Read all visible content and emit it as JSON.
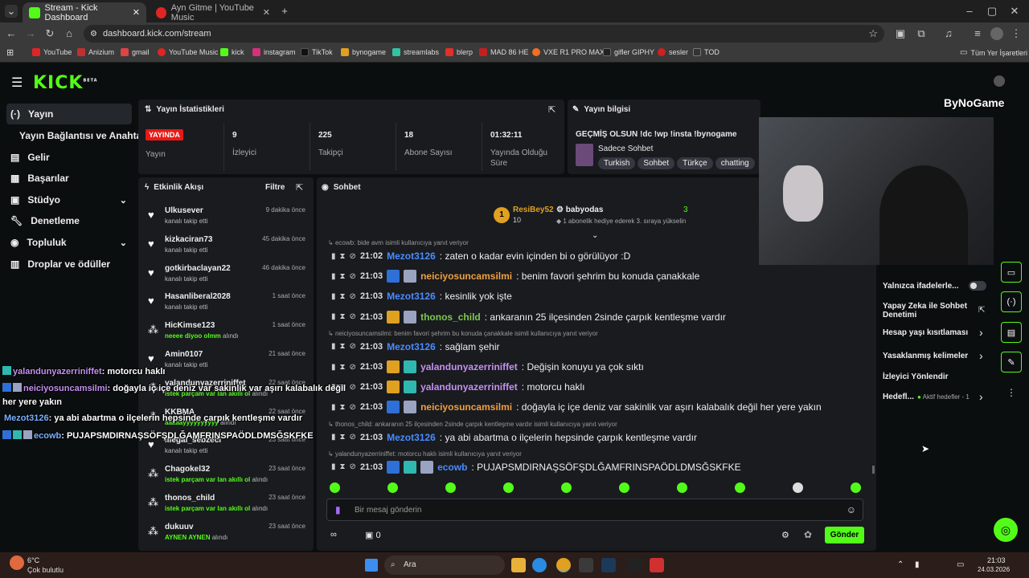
{
  "browser": {
    "tabs": [
      {
        "title": "Stream - Kick Dashboard"
      },
      {
        "title": "Ayn Gitme | YouTube Music"
      }
    ],
    "url": "dashboard.kick.com/stream",
    "bookmarks": [
      "YouTube",
      "Anizium",
      "gmail",
      "YouTube Music",
      "kick",
      "instagram",
      "TikTok",
      "bynogame",
      "streamlabs",
      "blerp",
      "MAD 86 HE",
      "VXE R1 PRO MAX",
      "gifler GIPHY",
      "sesler",
      "TOD"
    ],
    "all_bookmarks": "Tüm Yer İşaretleri"
  },
  "kick": {
    "logo": "KICK",
    "logo_sup": "BETA"
  },
  "sidebar": {
    "items": [
      {
        "label": "Yayın",
        "icon": "broadcast-icon"
      },
      {
        "label": "Yayın Bağlantısı ve Anahtarı"
      },
      {
        "label": "Gelir",
        "icon": "money-icon"
      },
      {
        "label": "Başarılar",
        "icon": "trophy-icon"
      },
      {
        "label": "Stüdyo",
        "icon": "studio-icon"
      },
      {
        "label": "Denetleme",
        "icon": "wrench-icon"
      },
      {
        "label": "Topluluk",
        "icon": "community-icon"
      },
      {
        "label": "Droplar ve ödüller",
        "icon": "gift-icon"
      }
    ]
  },
  "stats": {
    "title": "Yayın İstatistikleri",
    "live_badge": "YAYINDA",
    "live_label": "Yayın",
    "cells": [
      {
        "value": "9",
        "label": "İzleyici"
      },
      {
        "value": "225",
        "label": "Takipçi"
      },
      {
        "value": "18",
        "label": "Abone Sayısı"
      },
      {
        "value": "01:32:11",
        "label": "Yayında Olduğu Süre"
      }
    ]
  },
  "stream_info": {
    "title": "Yayın bilgisi",
    "stream_title": "GEÇMİŞ OLSUN !dc !wp !insta !bynogame",
    "category": "Sadece Sohbet",
    "tags": [
      "Turkish",
      "Sohbet",
      "Türkçe",
      "chatting"
    ]
  },
  "activity": {
    "title": "Etkinlik Akışı",
    "filter": "Filtre",
    "items": [
      {
        "name": "Ulkusever",
        "time": "9 dakika önce",
        "sub": "kanalı takip etti",
        "icon": "heart"
      },
      {
        "name": "kizkaciran73",
        "time": "45 dakika önce",
        "sub": "kanalı takip etti",
        "icon": "heart"
      },
      {
        "name": "gotkirbaclayan22",
        "time": "46 dakika önce",
        "sub": "kanalı takip etti",
        "icon": "heart"
      },
      {
        "name": "Hasanliberal2028",
        "time": "1 saat önce",
        "sub": "kanalı takip etti",
        "icon": "heart"
      },
      {
        "name": "HicKimse123",
        "time": "1 saat önce",
        "hl": "neeee diyoo olmm",
        "sub": "alındı",
        "icon": "reward"
      },
      {
        "name": "Amin0107",
        "time": "21 saat önce",
        "sub": "kanalı takip etti",
        "icon": "heart"
      },
      {
        "name": "yalandunyazerriniffet",
        "time": "22 saat önce",
        "hl": "istek parçam var lan akıllı ol",
        "sub": "alındı",
        "icon": "reward"
      },
      {
        "name": "KKBMA",
        "time": "22 saat önce",
        "hl": "aaaaayyyyyyyyyy",
        "sub": "alındı",
        "icon": "reward"
      },
      {
        "name": "illegal_sebzeci",
        "time": "23 saat önce",
        "sub": "kanalı takip etti",
        "icon": "heart"
      },
      {
        "name": "Chagokel32",
        "time": "23 saat önce",
        "hl": "istek parçam var lan akıllı ol",
        "sub": "alındı",
        "icon": "reward"
      },
      {
        "name": "thonos_child",
        "time": "23 saat önce",
        "hl": "istek parçam var lan akıllı ol",
        "sub": "alındı",
        "icon": "reward"
      },
      {
        "name": "dukuuv",
        "time": "23 saat önce",
        "hl": "AYNEN AYNEN",
        "sub": "alındı",
        "icon": "reward"
      }
    ]
  },
  "chat": {
    "title": "Sohbet",
    "pinned_user": "ResiBey52",
    "pinned_count": "10",
    "gift_user": "babyodas",
    "gift_count": "3",
    "gift_text": "1 abonelik hediye ederek 3. sıraya yükselin",
    "messages": [
      {
        "reply": "ecowb: bide avm isimli kullanıcıya yanıt veriyor",
        "time": "21:02",
        "user": "Mezot3126",
        "color": "#4a8cff",
        "text": ": zaten o kadar evin içinden bi o görülüyor :D",
        "badges": []
      },
      {
        "time": "21:03",
        "user": "neiciyosuncamsilmi",
        "color": "#f0a040",
        "text": ": benim favori şehrim bu konuda çanakkale",
        "badges": [
          "#2f6fd8",
          "#9aa3c0"
        ]
      },
      {
        "time": "21:03",
        "user": "Mezot3126",
        "color": "#4a8cff",
        "text": ": kesinlik yok işte",
        "badges": []
      },
      {
        "time": "21:03",
        "user": "thonos_child",
        "color": "#7ec850",
        "text": ": ankaranın 25 ilçesinden 2sinde çarpık kentleşme vardır",
        "badges": [
          "#e0a020",
          "#9aa3c0"
        ]
      },
      {
        "reply": "neiciyosuncamsilmi: benim favori şehrim bu konuda çanakkale isimli kullanıcıya yanıt veriyor",
        "time": "21:03",
        "user": "Mezot3126",
        "color": "#4a8cff",
        "text": ": sağlam şehir",
        "badges": []
      },
      {
        "time": "21:03",
        "user": "yalandunyazerriniffet",
        "color": "#c490f0",
        "text": ": Değişin konuyu ya çok sıktı",
        "badges": [
          "#e0a020",
          "#2fb8b0"
        ]
      },
      {
        "time": "21:03",
        "user": "yalandunyazerriniffet",
        "color": "#c490f0",
        "text": ": motorcu haklı",
        "badges": [
          "#e0a020",
          "#2fb8b0"
        ]
      },
      {
        "time": "21:03",
        "user": "neiciyosuncamsilmi",
        "color": "#f0a040",
        "text": ": doğayla iç içe deniz var sakinlik var aşırı kalabalık değil her yere yakın",
        "badges": [
          "#2f6fd8",
          "#9aa3c0"
        ]
      },
      {
        "reply": "thonos_child: ankaranın 25 ilçesinden 2sinde çarpık kentleşme vardır isimli kullanıcıya yanıt veriyor",
        "time": "21:03",
        "user": "Mezot3126",
        "color": "#4a8cff",
        "text": ": ya abi abartma o ilçelerin hepsinde çarpık kentleşme vardır",
        "badges": []
      },
      {
        "reply": "yalandunyazerriniffet: motorcu haklı isimli kullanıcıya yanıt veriyor",
        "time": "21:03",
        "user": "ecowb",
        "color": "#4a8cff",
        "text": ": PUJAPSMDIRNAŞSÖFŞDLĞAMFRINSPAÖDLDMSĞSKFKE",
        "badges": [
          "#2f6fd8",
          "#2fb8b0",
          "#9aa3c0"
        ]
      }
    ],
    "input_placeholder": "Bir mesaj gönderin",
    "points": "0",
    "send": "Gönder"
  },
  "overlay": {
    "brand": "ByNoGame",
    "lines": [
      {
        "user": "yalandunyazerriniffet",
        "text": ": motorcu haklı"
      },
      {
        "user": "neiciyosuncamsilmi",
        "text": ": doğayla iç içe deniz var sakinlik var aşırı kalabalık değil"
      },
      {
        "cont": "her yere yakın"
      },
      {
        "user": "Mezot3126",
        "text": ": ya abi abartma o ilçelerin hepsinde çarpık kentleşme vardır"
      },
      {
        "user": "ecowb",
        "text": ": PUJAPSMDIRNAŞSÖFŞDLĞAMFRINSPAÖDLDMSĞSKFKE"
      }
    ]
  },
  "settings": {
    "items": [
      {
        "label": "Yalnızca ifadelerle...",
        "toggle": true
      },
      {
        "label": "Yapay Zeka ile Sohbet Denetimi"
      },
      {
        "label": "Hesap yaşı kısıtlaması"
      },
      {
        "label": "Yasaklanmış kelimeler"
      },
      {
        "label": "İzleyici Yönlendir"
      },
      {
        "label": "Hedefl...",
        "extra": "Aktif hedefler - 1"
      }
    ]
  },
  "taskbar": {
    "weather_temp": "6°C",
    "weather_text": "Çok bulutlu",
    "search": "Ara",
    "time": "21:03",
    "date": "24.03.2026"
  },
  "colors": {
    "accent": "#53fc18",
    "live": "#e91916"
  }
}
